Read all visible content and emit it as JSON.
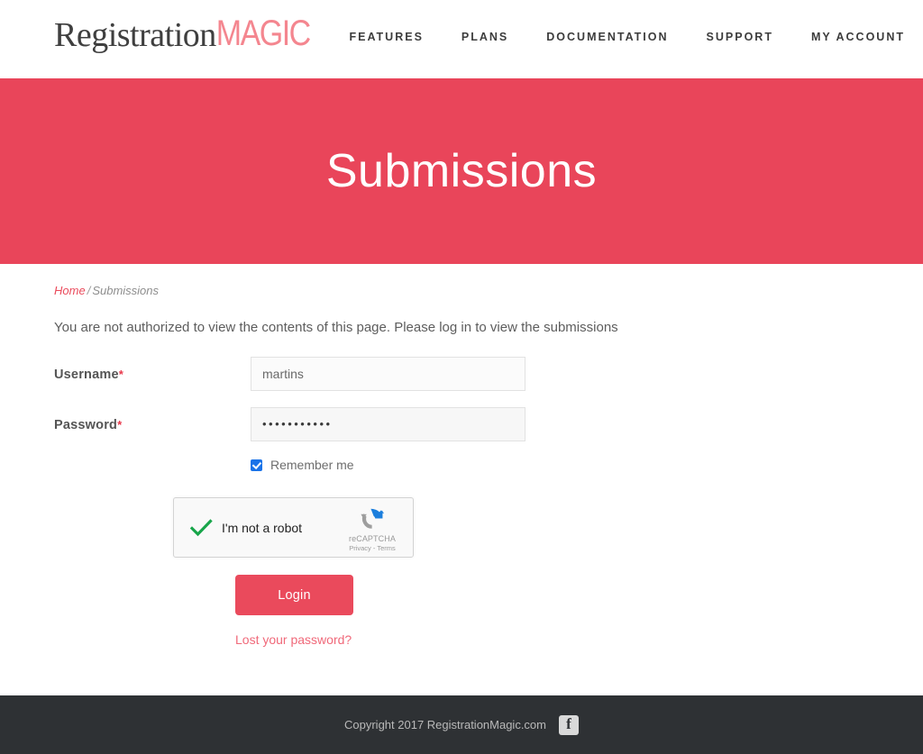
{
  "header": {
    "logo_primary": "Registration",
    "logo_secondary": "MAGIC",
    "nav": [
      {
        "label": "FEATURES",
        "name": "nav-features"
      },
      {
        "label": "PLANS",
        "name": "nav-plans"
      },
      {
        "label": "DOCUMENTATION",
        "name": "nav-documentation"
      },
      {
        "label": "SUPPORT",
        "name": "nav-support"
      },
      {
        "label": "MY ACCOUNT",
        "name": "nav-my-account"
      }
    ]
  },
  "hero": {
    "title": "Submissions",
    "background_color": "#e9455a"
  },
  "breadcrumb": {
    "home": "Home",
    "separator": "/",
    "current": "Submissions"
  },
  "notice": {
    "message": "You are not authorized to view the contents of this page. Please log in to view the submissions"
  },
  "form": {
    "username": {
      "label": "Username",
      "required_mark": "*",
      "value": "martins",
      "placeholder": "Username"
    },
    "password": {
      "label": "Password",
      "required_mark": "*",
      "masked_value": "•••••••••••",
      "placeholder": "Password"
    },
    "remember": {
      "label": "Remember me",
      "checked": true
    },
    "recaptcha": {
      "label": "I'm not a robot",
      "brand": "reCAPTCHA",
      "links": "Privacy - Terms",
      "verified": true
    },
    "submit_label": "Login",
    "lost_password_label": "Lost your password?"
  },
  "footer": {
    "copyright": "Copyright 2017 RegistrationMagic.com",
    "facebook_glyph": "f"
  },
  "colors": {
    "brand_red": "#ea4a5c",
    "hero_red": "#e9455a",
    "logo_pink": "#f4868f",
    "footer_dark": "#2e3134",
    "checkbox_blue": "#1a73e8",
    "check_green": "#18a54a"
  }
}
